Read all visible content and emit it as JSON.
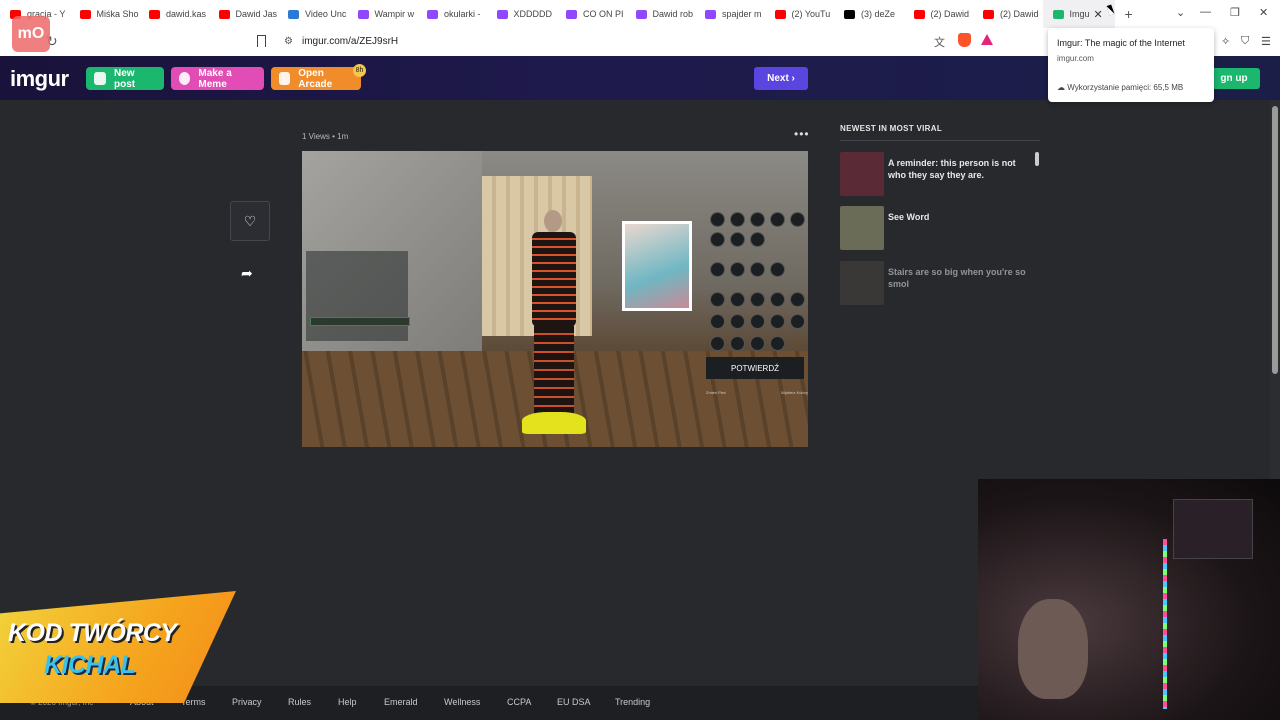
{
  "browser": {
    "tabs": [
      {
        "label": "gracja - Y",
        "color": "#ff0000"
      },
      {
        "label": "Miśka Sho",
        "color": "#ff0000"
      },
      {
        "label": "dawid.kas",
        "color": "#ff0000"
      },
      {
        "label": "Dawid Jas",
        "color": "#ff0000"
      },
      {
        "label": "Video Unc",
        "color": "#2b7bd6"
      },
      {
        "label": "Wampir w",
        "color": "#9146ff"
      },
      {
        "label": "okularki -",
        "color": "#9146ff"
      },
      {
        "label": "XDDDDD",
        "color": "#9146ff"
      },
      {
        "label": "CO ON PI",
        "color": "#9146ff"
      },
      {
        "label": "Dawid rob",
        "color": "#9146ff"
      },
      {
        "label": "spajder m",
        "color": "#9146ff"
      },
      {
        "label": "(2) YouTu",
        "color": "#ff0000"
      },
      {
        "label": "(3) deZe",
        "color": "#000000"
      },
      {
        "label": "(2) Dawid",
        "color": "#ff0000"
      },
      {
        "label": "(2) Dawid",
        "color": "#ff0000"
      }
    ],
    "active_tab": {
      "label": "Imgu",
      "close": "✕"
    },
    "new_tab": "+",
    "url": "imgur.com/a/ZEJ9srH",
    "hover_card": {
      "title": "Imgur: The magic of the Internet",
      "domain": "imgur.com",
      "memory": "Wykorzystanie pamięci: 65,5 MB"
    },
    "mo_logo": "mO"
  },
  "header": {
    "logo": "imgur",
    "new_post": "New post",
    "make_meme": "Make a Meme",
    "open_arcade": "Open Arcade",
    "arcade_badge": "8h",
    "next": "Next",
    "sign_up": "gn up"
  },
  "post": {
    "meta": "1 Views  •  1m",
    "more": "•••",
    "confirm_label": "POTWIERDŹ",
    "sub_left": "Zmień Płeć",
    "sub_right": "Wybierz Kolory"
  },
  "sidebar": {
    "title": "NEWEST IN MOST VIRAL",
    "items": [
      {
        "text": "A reminder: this person is not who they say they are.",
        "thumb": "#5a2a36"
      },
      {
        "text": "See Word",
        "thumb": "#6b6c58"
      },
      {
        "text": "Stairs are so big when you're so smol",
        "thumb": "#4a4440"
      }
    ]
  },
  "promo": {
    "line1": "KOD TWÓRCY",
    "line2": "KICHAL"
  },
  "footer": {
    "copyright": "© 2026 Imgur, Inc",
    "links": [
      "About",
      "Terms",
      "Privacy",
      "Rules",
      "Help",
      "Emerald",
      "Wellness",
      "CCPA",
      "EU DSA",
      "Trending"
    ]
  },
  "colors": {
    "accent_green": "#1bb76e",
    "accent_pink": "#e24cb5",
    "accent_orange": "#f18c2b",
    "accent_purple": "#5b45e0",
    "page_bg": "#27292d"
  }
}
